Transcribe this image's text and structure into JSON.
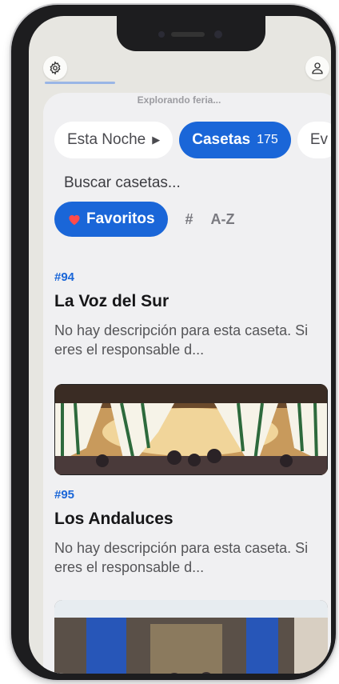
{
  "header": {
    "sheet_title": "Explorando feria..."
  },
  "tabs": [
    {
      "label": "Esta Noche"
    },
    {
      "label": "Casetas",
      "count": "175"
    },
    {
      "label": "Ev"
    }
  ],
  "search": {
    "placeholder": "Buscar casetas..."
  },
  "filters": {
    "favorites": "Favoritos",
    "number": "#",
    "alpha": "A-Z"
  },
  "casetas": [
    {
      "number": "#94",
      "name": "La Voz del Sur",
      "description": "No hay descripción para esta caseta. Si eres el responsable d..."
    },
    {
      "number": "#95",
      "name": "Los Andaluces",
      "description": "No hay descripción para esta caseta. Si eres el responsable d..."
    }
  ],
  "icons": [
    "gear-icon",
    "user-icon",
    "play-icon",
    "heart-icon"
  ],
  "colors": {
    "accent": "#1a66d8",
    "background": "#f0f0f2"
  }
}
